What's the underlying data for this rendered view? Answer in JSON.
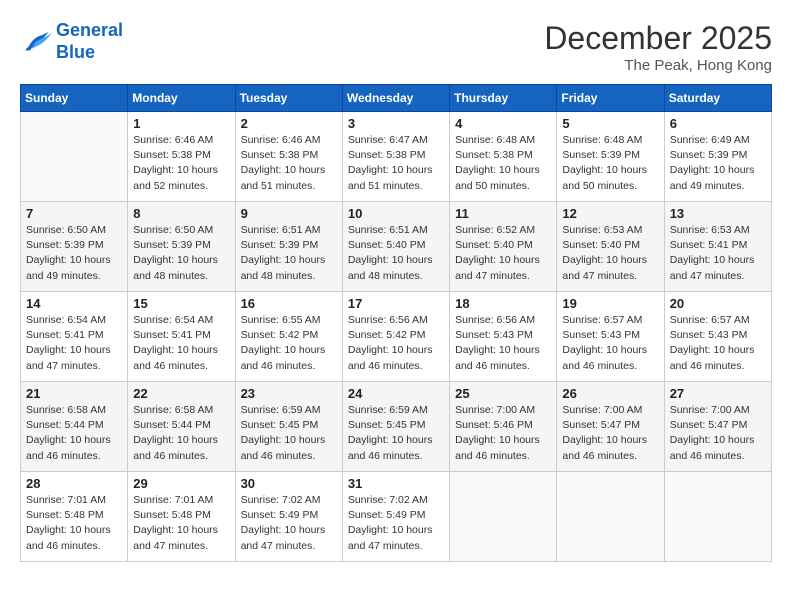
{
  "logo": {
    "line1": "General",
    "line2": "Blue"
  },
  "title": "December 2025",
  "subtitle": "The Peak, Hong Kong",
  "days_of_week": [
    "Sunday",
    "Monday",
    "Tuesday",
    "Wednesday",
    "Thursday",
    "Friday",
    "Saturday"
  ],
  "weeks": [
    [
      {
        "day": "",
        "info": ""
      },
      {
        "day": "1",
        "info": "Sunrise: 6:46 AM\nSunset: 5:38 PM\nDaylight: 10 hours\nand 52 minutes."
      },
      {
        "day": "2",
        "info": "Sunrise: 6:46 AM\nSunset: 5:38 PM\nDaylight: 10 hours\nand 51 minutes."
      },
      {
        "day": "3",
        "info": "Sunrise: 6:47 AM\nSunset: 5:38 PM\nDaylight: 10 hours\nand 51 minutes."
      },
      {
        "day": "4",
        "info": "Sunrise: 6:48 AM\nSunset: 5:38 PM\nDaylight: 10 hours\nand 50 minutes."
      },
      {
        "day": "5",
        "info": "Sunrise: 6:48 AM\nSunset: 5:39 PM\nDaylight: 10 hours\nand 50 minutes."
      },
      {
        "day": "6",
        "info": "Sunrise: 6:49 AM\nSunset: 5:39 PM\nDaylight: 10 hours\nand 49 minutes."
      }
    ],
    [
      {
        "day": "7",
        "info": "Sunrise: 6:50 AM\nSunset: 5:39 PM\nDaylight: 10 hours\nand 49 minutes."
      },
      {
        "day": "8",
        "info": "Sunrise: 6:50 AM\nSunset: 5:39 PM\nDaylight: 10 hours\nand 48 minutes."
      },
      {
        "day": "9",
        "info": "Sunrise: 6:51 AM\nSunset: 5:39 PM\nDaylight: 10 hours\nand 48 minutes."
      },
      {
        "day": "10",
        "info": "Sunrise: 6:51 AM\nSunset: 5:40 PM\nDaylight: 10 hours\nand 48 minutes."
      },
      {
        "day": "11",
        "info": "Sunrise: 6:52 AM\nSunset: 5:40 PM\nDaylight: 10 hours\nand 47 minutes."
      },
      {
        "day": "12",
        "info": "Sunrise: 6:53 AM\nSunset: 5:40 PM\nDaylight: 10 hours\nand 47 minutes."
      },
      {
        "day": "13",
        "info": "Sunrise: 6:53 AM\nSunset: 5:41 PM\nDaylight: 10 hours\nand 47 minutes."
      }
    ],
    [
      {
        "day": "14",
        "info": "Sunrise: 6:54 AM\nSunset: 5:41 PM\nDaylight: 10 hours\nand 47 minutes."
      },
      {
        "day": "15",
        "info": "Sunrise: 6:54 AM\nSunset: 5:41 PM\nDaylight: 10 hours\nand 46 minutes."
      },
      {
        "day": "16",
        "info": "Sunrise: 6:55 AM\nSunset: 5:42 PM\nDaylight: 10 hours\nand 46 minutes."
      },
      {
        "day": "17",
        "info": "Sunrise: 6:56 AM\nSunset: 5:42 PM\nDaylight: 10 hours\nand 46 minutes."
      },
      {
        "day": "18",
        "info": "Sunrise: 6:56 AM\nSunset: 5:43 PM\nDaylight: 10 hours\nand 46 minutes."
      },
      {
        "day": "19",
        "info": "Sunrise: 6:57 AM\nSunset: 5:43 PM\nDaylight: 10 hours\nand 46 minutes."
      },
      {
        "day": "20",
        "info": "Sunrise: 6:57 AM\nSunset: 5:43 PM\nDaylight: 10 hours\nand 46 minutes."
      }
    ],
    [
      {
        "day": "21",
        "info": "Sunrise: 6:58 AM\nSunset: 5:44 PM\nDaylight: 10 hours\nand 46 minutes."
      },
      {
        "day": "22",
        "info": "Sunrise: 6:58 AM\nSunset: 5:44 PM\nDaylight: 10 hours\nand 46 minutes."
      },
      {
        "day": "23",
        "info": "Sunrise: 6:59 AM\nSunset: 5:45 PM\nDaylight: 10 hours\nand 46 minutes."
      },
      {
        "day": "24",
        "info": "Sunrise: 6:59 AM\nSunset: 5:45 PM\nDaylight: 10 hours\nand 46 minutes."
      },
      {
        "day": "25",
        "info": "Sunrise: 7:00 AM\nSunset: 5:46 PM\nDaylight: 10 hours\nand 46 minutes."
      },
      {
        "day": "26",
        "info": "Sunrise: 7:00 AM\nSunset: 5:47 PM\nDaylight: 10 hours\nand 46 minutes."
      },
      {
        "day": "27",
        "info": "Sunrise: 7:00 AM\nSunset: 5:47 PM\nDaylight: 10 hours\nand 46 minutes."
      }
    ],
    [
      {
        "day": "28",
        "info": "Sunrise: 7:01 AM\nSunset: 5:48 PM\nDaylight: 10 hours\nand 46 minutes."
      },
      {
        "day": "29",
        "info": "Sunrise: 7:01 AM\nSunset: 5:48 PM\nDaylight: 10 hours\nand 47 minutes."
      },
      {
        "day": "30",
        "info": "Sunrise: 7:02 AM\nSunset: 5:49 PM\nDaylight: 10 hours\nand 47 minutes."
      },
      {
        "day": "31",
        "info": "Sunrise: 7:02 AM\nSunset: 5:49 PM\nDaylight: 10 hours\nand 47 minutes."
      },
      {
        "day": "",
        "info": ""
      },
      {
        "day": "",
        "info": ""
      },
      {
        "day": "",
        "info": ""
      }
    ]
  ]
}
